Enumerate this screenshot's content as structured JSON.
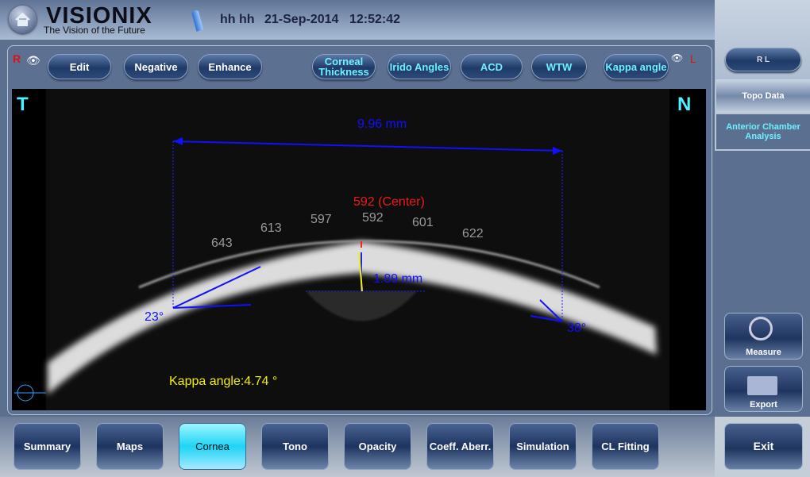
{
  "header": {
    "brand": "VISIONIX",
    "tagline": "The Vision of the Future",
    "patient": "hh hh",
    "date": "21-Sep-2014",
    "time": "12:52:42"
  },
  "toolbar": {
    "right_eye": "R",
    "left_eye": "L",
    "edit": "Edit",
    "negative": "Negative",
    "enhance": "Enhance",
    "corneal_thickness": "Corneal Thickness",
    "irido_angles": "Irido Angles",
    "acd": "ACD",
    "wtw": "WTW",
    "kappa_angle": "Kappa angle"
  },
  "viewer": {
    "temporal": "T",
    "nasal": "N",
    "wtw": "9.96 mm",
    "center_thickness": "592 (Center)",
    "thickness_values": [
      "643",
      "613",
      "597",
      "592",
      "601",
      "622"
    ],
    "acd": "1.89 mm",
    "left_angle": "23°",
    "right_angle": "38°",
    "kappa": "Kappa angle:4.74 °"
  },
  "sidebar": {
    "eye_toggle": "R L",
    "topo_data": "Topo Data",
    "anterior_chamber": "Anterior Chamber Analysis",
    "measure": "Measure",
    "export": "Export",
    "exit": "Exit"
  },
  "tabs": [
    "Summary",
    "Maps",
    "Cornea",
    "Tono",
    "Opacity",
    "Coeff. Aberr.",
    "Simulation",
    "CL Fitting"
  ],
  "active_tab": "Cornea"
}
